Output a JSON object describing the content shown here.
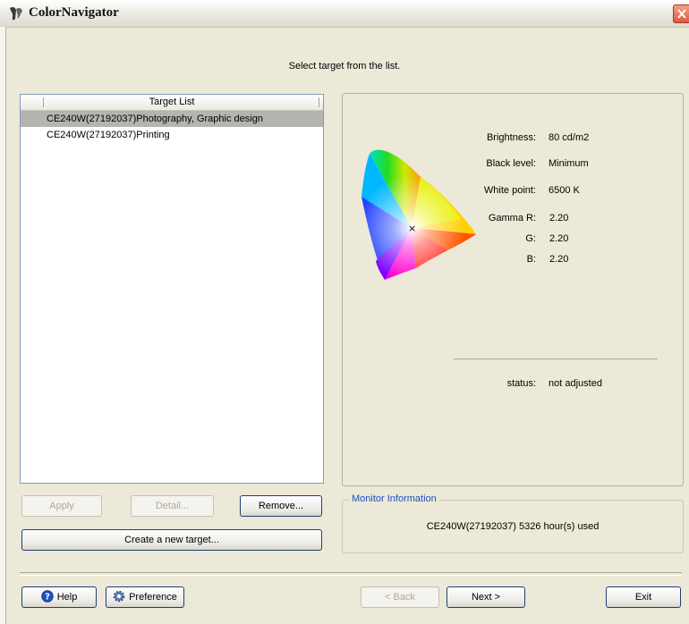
{
  "window": {
    "title": "ColorNavigator"
  },
  "instruction": "Select target from the list.",
  "target_list": {
    "header": "Target List",
    "items": [
      {
        "label": "CE240W(27192037)Photography, Graphic design",
        "selected": true
      },
      {
        "label": "CE240W(27192037)Printing",
        "selected": false
      }
    ]
  },
  "list_buttons": {
    "apply": "Apply",
    "detail": "Detail...",
    "remove": "Remove...",
    "create": "Create a new target..."
  },
  "target_info": {
    "brightness_label": "Brightness:",
    "brightness_value": "80 cd/m2",
    "black_level_label": "Black level:",
    "black_level_value": "Minimum",
    "white_point_label": "White point:",
    "white_point_value": "6500 K",
    "gamma_r_label": "Gamma R:",
    "gamma_r_value": "2.20",
    "gamma_g_label": "G:",
    "gamma_g_value": "2.20",
    "gamma_b_label": "B:",
    "gamma_b_value": "2.20",
    "status_label": "status:",
    "status_value": "not adjusted",
    "gamut_marker": "×"
  },
  "monitor_info": {
    "legend": "Monitor Information",
    "text": "CE240W(27192037) 5326 hour(s) used"
  },
  "footer": {
    "help": "Help",
    "preference": "Preference",
    "back": "< Back",
    "next": "Next >",
    "exit": "Exit"
  },
  "colors": {
    "window_bg": "#ece9d8",
    "selection": "#b6b4ae",
    "legend_blue": "#1b4fbf",
    "close_red": "#df5a3c"
  }
}
